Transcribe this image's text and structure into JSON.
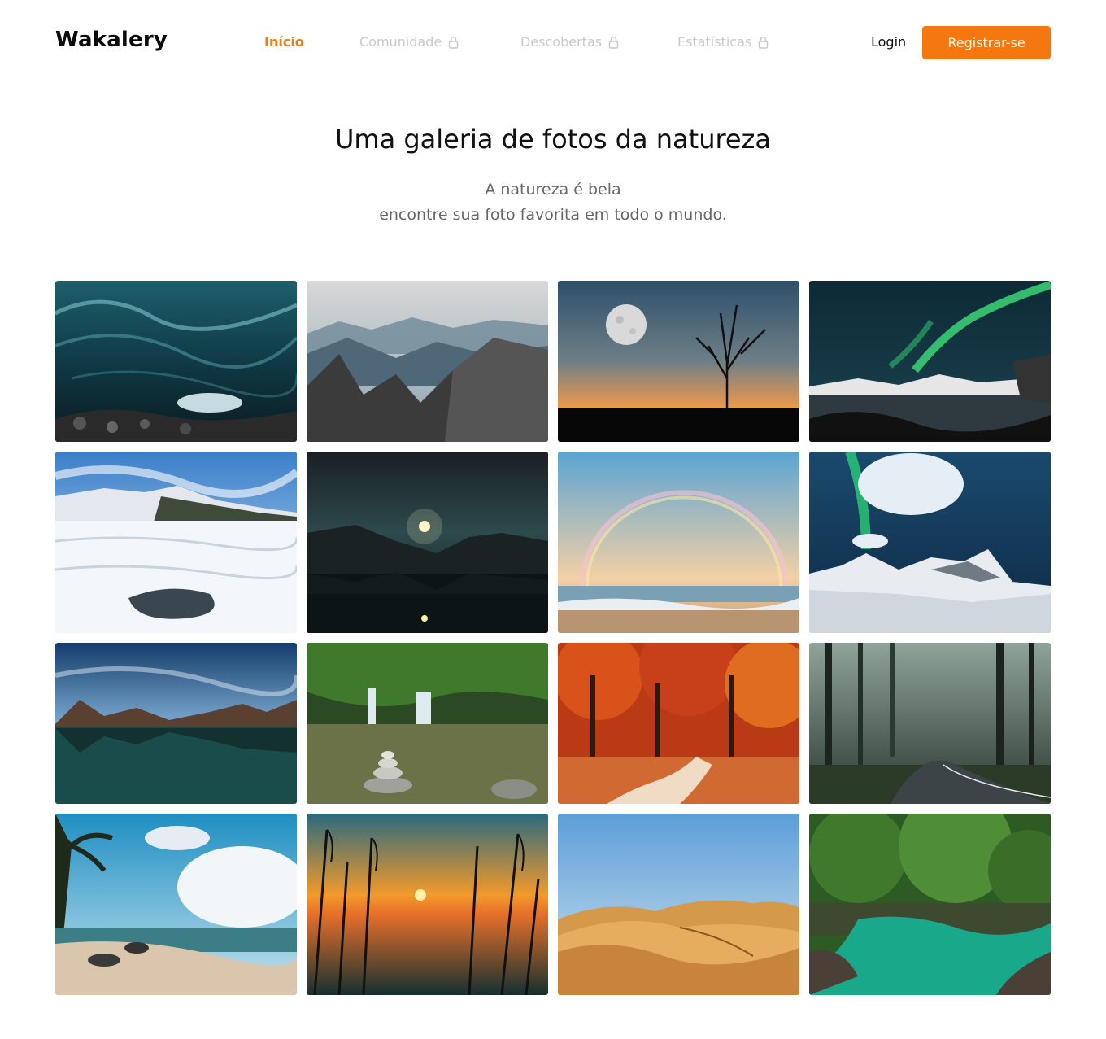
{
  "header": {
    "logo": "Wakalery",
    "nav": [
      {
        "label": "Início",
        "active": true,
        "locked": false
      },
      {
        "label": "Comunidade",
        "active": false,
        "locked": true
      },
      {
        "label": "Descobertas",
        "active": false,
        "locked": true
      },
      {
        "label": "Estatísticas",
        "active": false,
        "locked": true
      }
    ],
    "login_label": "Login",
    "register_label": "Registrar-se"
  },
  "hero": {
    "title": "Uma galeria de fotos da natureza",
    "subtitle_line1": "A natureza é bela",
    "subtitle_line2": "encontre sua foto favorita em todo o mundo."
  },
  "gallery": {
    "photos": [
      {
        "subject": "ice-cave"
      },
      {
        "subject": "misty-mountains"
      },
      {
        "subject": "moon-tree-sunset"
      },
      {
        "subject": "aurora-coast"
      },
      {
        "subject": "snowy-field"
      },
      {
        "subject": "moonlit-lake"
      },
      {
        "subject": "rainbow-beach"
      },
      {
        "subject": "aurora-snow-mountains"
      },
      {
        "subject": "mountain-lake"
      },
      {
        "subject": "waterfall-stones"
      },
      {
        "subject": "autumn-forest"
      },
      {
        "subject": "forest-road"
      },
      {
        "subject": "tropical-beach"
      },
      {
        "subject": "reeds-sunset"
      },
      {
        "subject": "desert-dunes"
      },
      {
        "subject": "jungle-river"
      }
    ]
  },
  "colors": {
    "accent": "#f4780f",
    "nav_active": "#f07a1a",
    "nav_locked": "#c9c9c9"
  }
}
